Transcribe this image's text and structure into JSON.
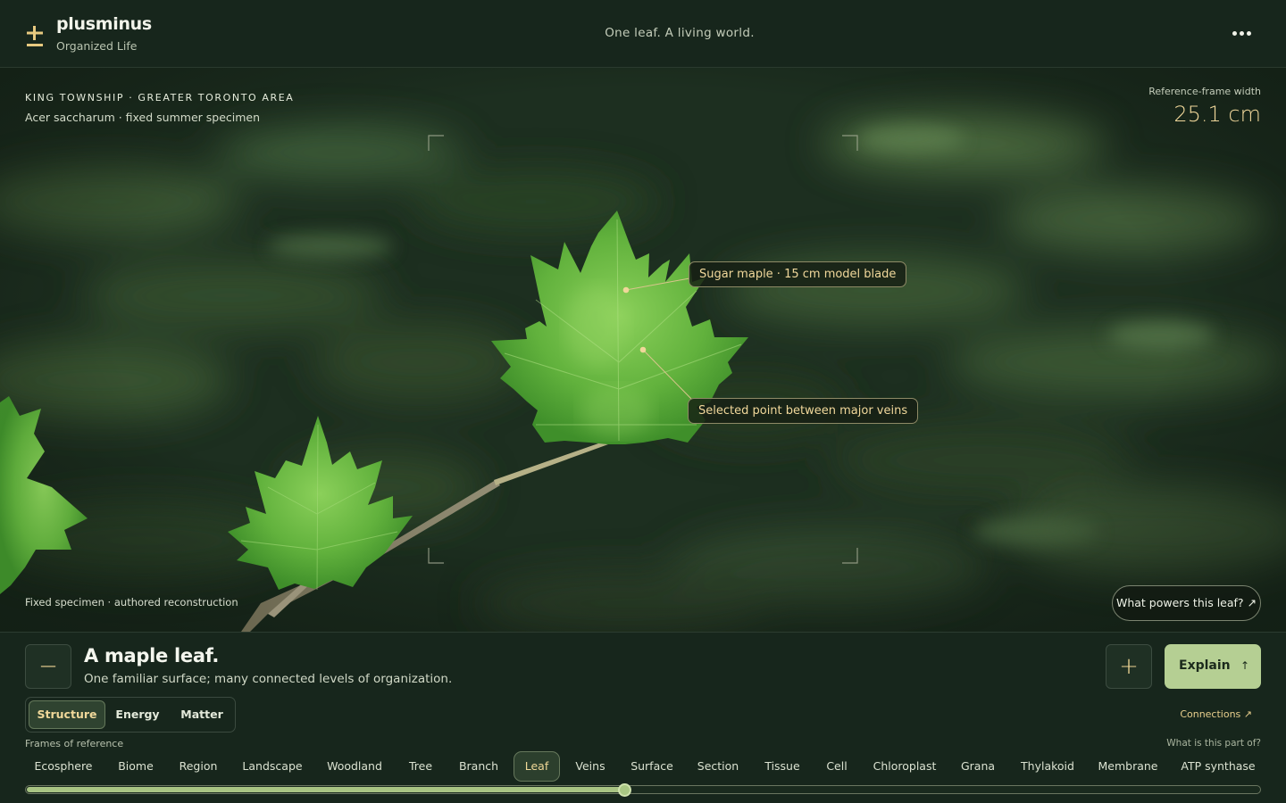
{
  "header": {
    "brand_name": "plusminus",
    "brand_sub": "Organized Life",
    "tagline": "One leaf. A living world.",
    "menu_icon": "more-horizontal-icon"
  },
  "scene": {
    "location_title": "KING TOWNSHIP · GREATER TORONTO AREA",
    "location_sub": "Acer saccharum · fixed summer specimen",
    "reference_label": "Reference-frame width",
    "reference_value": "25.1 cm",
    "callout_blade": "Sugar maple · 15 cm model blade",
    "callout_point": "Selected point between major veins",
    "footnote": "Fixed specimen · authored reconstruction",
    "what_powers": "What powers this leaf? ↗"
  },
  "panel": {
    "zoom_out_label": "−",
    "zoom_in_label": "+",
    "title": "A maple leaf.",
    "subtitle": "One familiar surface; many connected levels of organization.",
    "explain_label": "Explain",
    "explain_arrow": "↑",
    "modes": [
      "Structure",
      "Energy",
      "Matter"
    ],
    "active_mode": "Structure",
    "connections": "Connections ↗",
    "frames_label": "Frames of reference",
    "part_of": "What is this part of?",
    "scales": [
      "Ecosphere",
      "Biome",
      "Region",
      "Landscape",
      "Woodland",
      "Tree",
      "Branch",
      "Leaf",
      "Veins",
      "Surface",
      "Section",
      "Tissue",
      "Cell",
      "Chloroplast",
      "Grana",
      "Thylakoid",
      "Membrane",
      "ATP synthase"
    ],
    "active_scale": "Leaf",
    "slider_fraction": 0.485
  },
  "colors": {
    "accent_gold": "#f0d89a",
    "explain_green": "#b5cf93",
    "leaf_green": "#5fb23c",
    "background": "#16231a"
  }
}
